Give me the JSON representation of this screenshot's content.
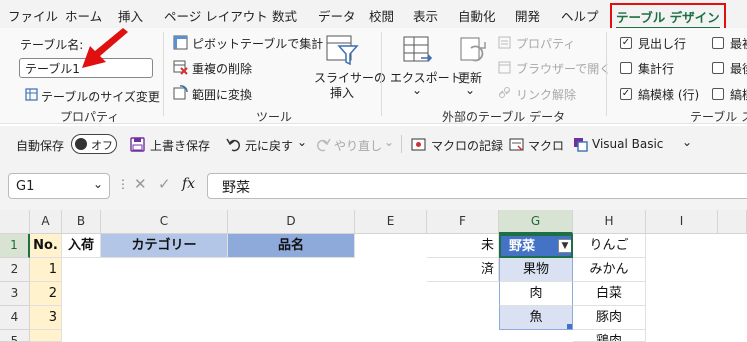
{
  "menu": {
    "items": [
      "ファイル",
      "ホーム",
      "挿入",
      "ページ レイアウト",
      "数式",
      "データ",
      "校閲",
      "表示",
      "自動化",
      "開発",
      "ヘルプ"
    ],
    "active": "テーブル デザイン"
  },
  "ribbon": {
    "props": {
      "name_label": "テーブル名:",
      "name_value": "テーブル1",
      "resize": "テーブルのサイズ変更",
      "group": "プロパティ"
    },
    "tools": {
      "pivot": "ピボットテーブルで集計",
      "remove_dup": "重複の削除",
      "convert": "範囲に変換",
      "slicer_line1": "スライサーの",
      "slicer_line2": "挿入",
      "group": "ツール"
    },
    "external": {
      "export": "エクスポート",
      "refresh": "更新",
      "properties": "プロパティ",
      "open_browser": "ブラウザーで開く",
      "unlink": "リンク解除",
      "group": "外部のテーブル データ"
    },
    "style_options": {
      "header_row": "見出し行",
      "total_row": "集計行",
      "banded_rows": "縞模様 (行)",
      "first_col": "最初",
      "last_col": "最後",
      "banded_cols": "縞模",
      "group": "テーブル スタ"
    }
  },
  "qat": {
    "autosave": "自動保存",
    "autosave_state": "オフ",
    "save": "上書き保存",
    "undo": "元に戻す",
    "redo": "やり直し",
    "record_macro": "マクロの記録",
    "macro": "マクロ",
    "vba": "Visual Basic"
  },
  "formula_bar": {
    "cell_ref": "G1",
    "fx": "fx",
    "content": "野菜"
  },
  "sheet": {
    "columns": [
      "A",
      "B",
      "C",
      "D",
      "E",
      "F",
      "G",
      "H",
      "I"
    ],
    "rows": [
      "1",
      "2",
      "3",
      "4",
      "5"
    ],
    "header": {
      "A": "No.",
      "B": "入荷",
      "C": "カテゴリー",
      "D": "品名"
    },
    "a_values": [
      "1",
      "2",
      "3"
    ],
    "f_values": [
      "未",
      "済"
    ],
    "table_header": "野菜",
    "table_values": [
      "果物",
      "肉",
      "魚"
    ],
    "h_values": [
      "りんご",
      "みかん",
      "白菜",
      "豚肉",
      "鶏肉"
    ]
  },
  "colors": {
    "accent_green": "#1d7044",
    "table_header_blue": "#4472c4",
    "table_band_blue": "#d9e1f2",
    "header_fill": "#8eaadb",
    "annotation_red": "#e01010"
  }
}
